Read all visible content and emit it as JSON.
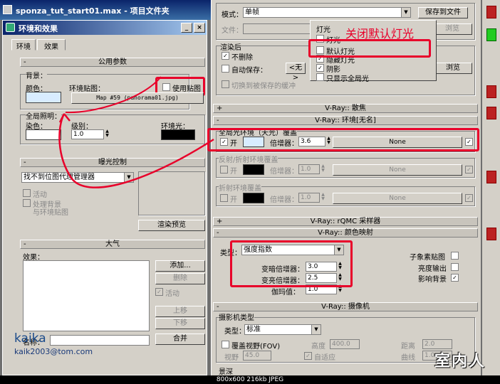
{
  "max_title": "sponza_tut_start01.max  - 项目文件夹",
  "env_dialog": {
    "title": "环境和效果",
    "tabs": [
      "环境",
      "效果"
    ],
    "common_params": {
      "header": "公用参数",
      "background_label": "背景：",
      "color_label": "颜色：",
      "env_map_label": "环境贴图：",
      "use_map_label": "使用贴图",
      "map_button": "Map #59  (panorama01.jpg)",
      "global_light_label": "全局照明：",
      "tint_label": "染色：",
      "level_label": "级别：",
      "level_value": "1.0",
      "ambient_label": "环境光："
    },
    "exposure": {
      "header": "曝光控制",
      "dropdown": "找不到位图代理管理器",
      "active_label": "活动",
      "process_bg_label": "处理背景",
      "process_bg_label2": "与环境贴图",
      "render_preview": "渲染预览"
    },
    "atmosphere": {
      "header": "大气",
      "effects_label": "效果：",
      "add": "添加...",
      "delete": "删除",
      "active": "活动",
      "move_up": "上移",
      "move_down": "下移",
      "merge": "合并",
      "name_label": "名称："
    }
  },
  "render_panel": {
    "mode_label": "模式：",
    "mode_value": "单帧",
    "save_to_file": "保存到文件",
    "file_label": "文件：",
    "browse1": "浏览",
    "render_window_label": "渲染后",
    "dont_delete": "不删除",
    "auto_save": "自动保存：",
    "none_btn": "<无>",
    "browse2": "浏览",
    "switch_to_saved": "切换到被保存的缓冲",
    "popup": {
      "header": "灯光",
      "items": [
        "灯光",
        "默认灯光",
        "隐藏灯光",
        "阴影",
        "只显示全局光"
      ],
      "note": "关闭默认灯光"
    },
    "caustics": "V-Ray:: 散焦",
    "environment": {
      "header": "V-Ray:: 环境[无名]",
      "gi_group": "全局光环境（天光）覆盖",
      "on_label": "开",
      "multiplier_label": "倍增器：",
      "gi_mult": "3.6",
      "gi_map": "None",
      "refl_group": "反射/折射环境覆盖",
      "refl_mult": "1.0",
      "refl_map": "None",
      "refr_group": "折射环境覆盖",
      "refr_mult": "1.0",
      "refr_map": "None"
    },
    "qmc": "V-Ray:: rQMC 采样器",
    "color_mapping": {
      "header": "V-Ray:: 颜色映射",
      "type_label": "类型：",
      "type_value": "强度指数",
      "dark_mult_label": "变暗倍增器：",
      "dark_mult": "3.0",
      "bright_mult_label": "变亮倍增器：",
      "bright_mult": "2.5",
      "gamma_label": "伽玛值：",
      "gamma": "1.0",
      "subpixel": "子象素贴图",
      "clamp": "亮度输出",
      "affect_bg": "影响背景"
    },
    "camera": {
      "header": "V-Ray:: 摄像机",
      "type_group": "摄影机类型",
      "type_label": "类型：",
      "type_value": "标准",
      "override_fov": "覆盖视野(FOV)",
      "fov_label": "视野",
      "fov_value": "45.0",
      "height_label": "高度",
      "height_value": "400.0",
      "adaptive": "自适应",
      "distance_label": "距离",
      "distance_value": "2.0",
      "curve_label": "曲线",
      "curve_value": "1.0",
      "dof_label": "景深"
    }
  },
  "logo": {
    "brand": "kaika",
    "email": "kaik2003@tom.com"
  },
  "watermark": "室内人",
  "status_text": "800x600  216kb  JPEG",
  "colors": {
    "highlight": "#e8002a",
    "note": "#e8002a",
    "swatch_bg": "#d8ecff"
  }
}
